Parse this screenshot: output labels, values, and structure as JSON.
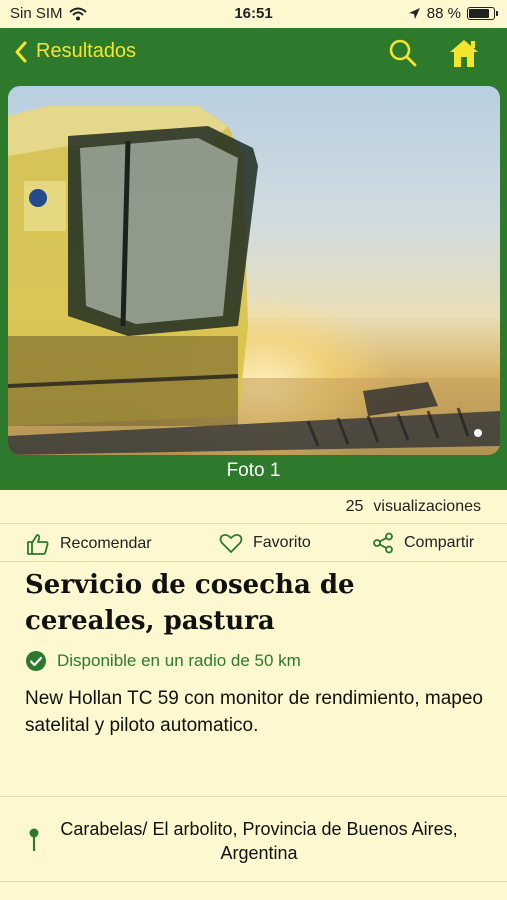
{
  "status_bar": {
    "carrier": "Sin SIM",
    "time": "16:51",
    "battery_percent": "88 %"
  },
  "nav": {
    "back_label": "Resultados",
    "icons": [
      "search-icon",
      "home-icon"
    ]
  },
  "gallery": {
    "caption": "Foto 1"
  },
  "stats": {
    "views_count": "25",
    "views_label": "visualizaciones"
  },
  "actions": {
    "recommend_label": "Recomendar",
    "favorite_label": "Favorito",
    "share_label": "Compartir"
  },
  "listing": {
    "title": "Servicio de cosecha de cereales, pastura",
    "availability": "Disponible en un radio de 50 km",
    "description": "New Hollan TC 59 con monitor de rendimiento, mapeo satelital y piloto automatico.",
    "location": "Carabelas/ El arbolito, Provincia de Buenos Aires, Argentina"
  },
  "colors": {
    "primary_green": "#2d7a2d",
    "accent_yellow": "#f5e52c",
    "background": "#fdf8d0"
  }
}
